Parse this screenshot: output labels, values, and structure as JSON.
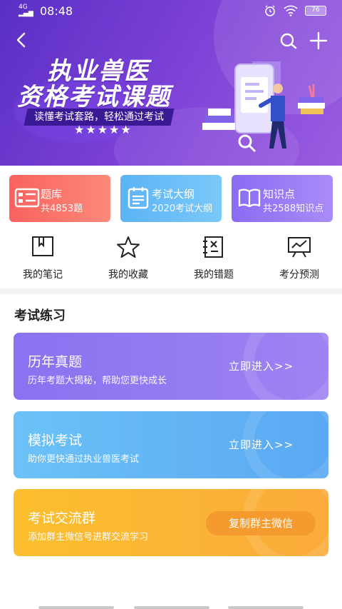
{
  "status_bar": {
    "signal": "4G",
    "time": "08:48",
    "battery": "76"
  },
  "header": {
    "title_line1": "执业兽医",
    "title_line2": "资格考试课题",
    "tagline": "读懂考试套路，轻松通过考试",
    "stars": "★★★★★"
  },
  "categories": [
    {
      "title": "题库",
      "subtitle": "共4853题",
      "icon": "question-bank-icon"
    },
    {
      "title": "考试大纲",
      "subtitle": "2020考试大纲",
      "icon": "syllabus-icon"
    },
    {
      "title": "知识点",
      "subtitle": "共2588知识点",
      "icon": "knowledge-book-icon"
    }
  ],
  "quick_actions": [
    {
      "label": "我的笔记",
      "icon": "notebook-icon"
    },
    {
      "label": "我的收藏",
      "icon": "star-icon"
    },
    {
      "label": "我的错题",
      "icon": "mistakes-icon"
    },
    {
      "label": "考分预测",
      "icon": "score-prediction-icon"
    }
  ],
  "section_title": "考试练习",
  "practice": [
    {
      "title": "历年真题",
      "desc": "历年考题大揭秘，帮助您更快成长",
      "action": "立即进入>>"
    },
    {
      "title": "模拟考试",
      "desc": "助你更快通过执业兽医考试",
      "action": "立即进入>>"
    },
    {
      "title": "考试交流群",
      "desc": "添加群主微信号进群交流学习",
      "action": "复制群主微信"
    }
  ],
  "colors": {
    "banner": "#6a36cf",
    "card_red": "#f9625e",
    "card_blue": "#5cb4f6",
    "card_purple": "#8a6cf4",
    "practice_purple": "#8a72f0",
    "practice_blue": "#6cc2f6",
    "practice_orange": "#fbbf2e"
  }
}
